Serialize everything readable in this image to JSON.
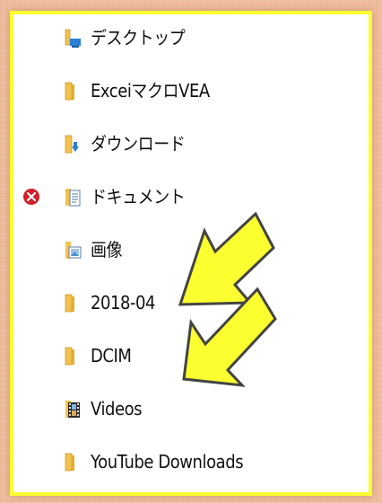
{
  "folders": [
    {
      "label": "デスクトップ",
      "icon": "desktop-folder-icon"
    },
    {
      "label": "ExceiマクロVEA",
      "icon": "folder-icon"
    },
    {
      "label": "ダウンロード",
      "icon": "downloads-folder-icon"
    },
    {
      "label": "ドキュメント",
      "icon": "documents-folder-icon",
      "status_icon": "error-x-icon"
    },
    {
      "label": "画像",
      "icon": "pictures-folder-icon"
    },
    {
      "label": "2018-04",
      "icon": "folder-icon"
    },
    {
      "label": "DCIM",
      "icon": "folder-icon"
    },
    {
      "label": "Videos",
      "icon": "videos-folder-icon"
    },
    {
      "label": "YouTube Downloads",
      "icon": "folder-icon"
    }
  ],
  "colors": {
    "highlight_border": "#fcff2f",
    "arrow_fill": "#fcff2f",
    "arrow_stroke": "#444444",
    "folder_yellow": "#f2c14e",
    "error_red": "#d0202a",
    "background": "#eebd9c"
  },
  "annotations": [
    {
      "type": "arrow",
      "icon": "yellow-arrow-icon",
      "points_to": "2018-04"
    },
    {
      "type": "arrow",
      "icon": "yellow-arrow-icon",
      "points_to": "DCIM"
    }
  ]
}
